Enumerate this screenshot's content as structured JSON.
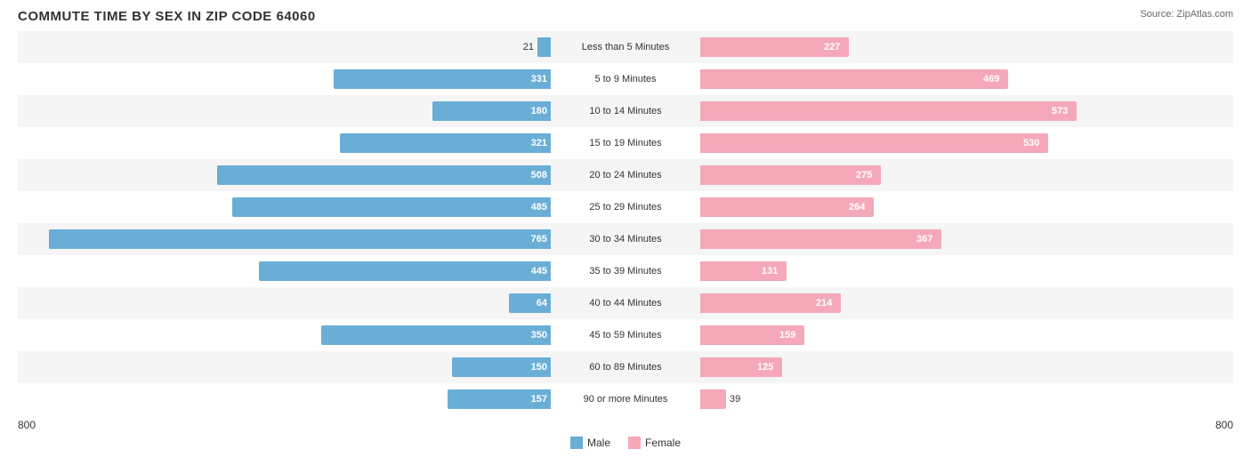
{
  "title": "COMMUTE TIME BY SEX IN ZIP CODE 64060",
  "source": "Source: ZipAtlas.com",
  "axis_min": "800",
  "axis_max": "800",
  "legend": {
    "male_label": "Male",
    "female_label": "Female"
  },
  "rows": [
    {
      "label": "Less than 5 Minutes",
      "male": 21,
      "female": 227
    },
    {
      "label": "5 to 9 Minutes",
      "male": 331,
      "female": 469
    },
    {
      "label": "10 to 14 Minutes",
      "male": 180,
      "female": 573
    },
    {
      "label": "15 to 19 Minutes",
      "male": 321,
      "female": 530
    },
    {
      "label": "20 to 24 Minutes",
      "male": 508,
      "female": 275
    },
    {
      "label": "25 to 29 Minutes",
      "male": 485,
      "female": 264
    },
    {
      "label": "30 to 34 Minutes",
      "male": 765,
      "female": 367
    },
    {
      "label": "35 to 39 Minutes",
      "male": 445,
      "female": 131
    },
    {
      "label": "40 to 44 Minutes",
      "male": 64,
      "female": 214
    },
    {
      "label": "45 to 59 Minutes",
      "male": 350,
      "female": 159
    },
    {
      "label": "60 to 89 Minutes",
      "male": 150,
      "female": 125
    },
    {
      "label": "90 or more Minutes",
      "male": 157,
      "female": 39
    }
  ],
  "max_value": 800
}
